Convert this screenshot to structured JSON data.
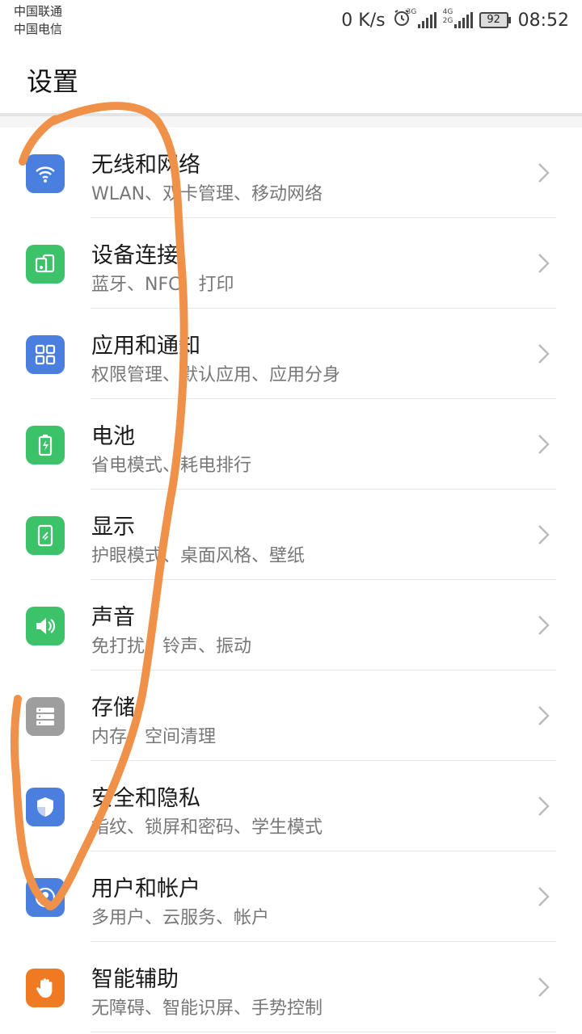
{
  "status": {
    "carrier1": "中国联通",
    "carrier2": "中国电信",
    "speed": "0 K/s",
    "net1": "3G",
    "net2": "4G",
    "net2b": "2G",
    "battery": "92",
    "time": "08:52"
  },
  "header": {
    "title": "设置"
  },
  "items": [
    {
      "title": "无线和网络",
      "subtitle": "WLAN、双卡管理、移动网络",
      "icon": "wifi-icon",
      "color": "#4a7fe0"
    },
    {
      "title": "设备连接",
      "subtitle": "蓝牙、NFC、打印",
      "icon": "device-connect-icon",
      "color": "#3cc268"
    },
    {
      "title": "应用和通知",
      "subtitle": "权限管理、默认应用、应用分身",
      "icon": "apps-grid-icon",
      "color": "#4a7fe0"
    },
    {
      "title": "电池",
      "subtitle": "省电模式、耗电排行",
      "icon": "battery-icon",
      "color": "#3cc268"
    },
    {
      "title": "显示",
      "subtitle": "护眼模式、桌面风格、壁纸",
      "icon": "display-icon",
      "color": "#3cc268"
    },
    {
      "title": "声音",
      "subtitle": "免打扰、铃声、振动",
      "icon": "sound-icon",
      "color": "#3cc268"
    },
    {
      "title": "存储",
      "subtitle": "内存、空间清理",
      "icon": "storage-icon",
      "color": "#9e9e9e"
    },
    {
      "title": "安全和隐私",
      "subtitle": "指纹、锁屏和密码、学生模式",
      "icon": "shield-icon",
      "color": "#4a7fe0"
    },
    {
      "title": "用户和帐户",
      "subtitle": "多用户、云服务、帐户",
      "icon": "user-icon",
      "color": "#4a7fe0"
    },
    {
      "title": "智能辅助",
      "subtitle": "无障碍、智能识屏、手势控制",
      "icon": "hand-icon",
      "color": "#f07a22"
    }
  ],
  "annotation": {
    "color": "#f0914a"
  }
}
